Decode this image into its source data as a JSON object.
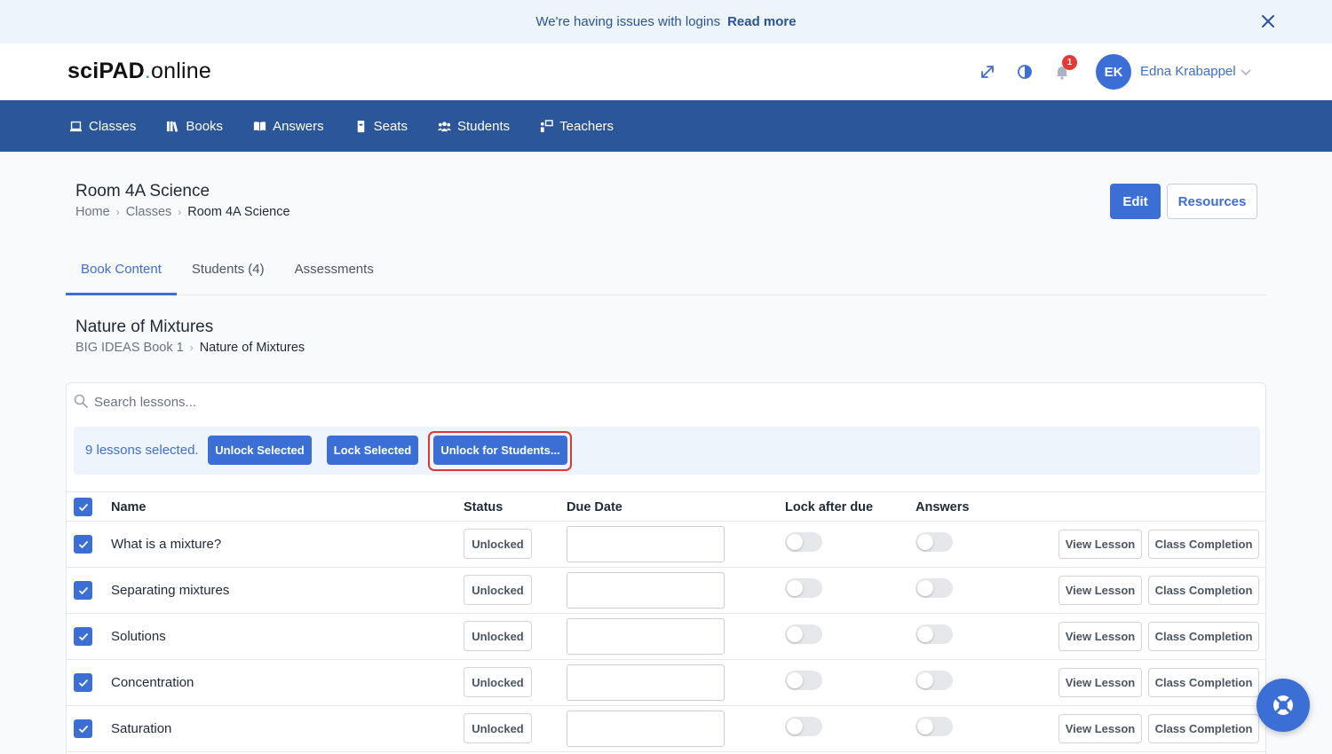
{
  "banner": {
    "message": "We're having issues with logins",
    "link": "Read more"
  },
  "header": {
    "logo": {
      "bold": "sciPAD",
      "dot": ".",
      "rest": "online"
    },
    "notification_count": "1",
    "user": {
      "initials": "EK",
      "name": "Edna Krabappel"
    }
  },
  "nav": {
    "items": [
      {
        "label": "Classes",
        "icon": "classes-icon"
      },
      {
        "label": "Books",
        "icon": "books-icon"
      },
      {
        "label": "Answers",
        "icon": "answers-icon"
      },
      {
        "label": "Seats",
        "icon": "seats-icon"
      },
      {
        "label": "Students",
        "icon": "students-icon"
      },
      {
        "label": "Teachers",
        "icon": "teachers-icon"
      }
    ]
  },
  "page": {
    "title": "Room 4A Science",
    "breadcrumb": [
      "Home",
      "Classes",
      "Room 4A Science"
    ],
    "edit_label": "Edit",
    "resources_label": "Resources"
  },
  "tabs": [
    {
      "label": "Book Content",
      "active": true
    },
    {
      "label": "Students (4)",
      "active": false
    },
    {
      "label": "Assessments",
      "active": false
    }
  ],
  "section": {
    "title": "Nature of Mixtures",
    "breadcrumb": [
      "BIG IDEAS Book 1",
      "Nature of Mixtures"
    ]
  },
  "search": {
    "placeholder": "Search lessons..."
  },
  "selection": {
    "text": "9 lessons selected.",
    "unlock_selected": "Unlock Selected",
    "lock_selected": "Lock Selected",
    "unlock_for_students": "Unlock for Students..."
  },
  "table": {
    "columns": {
      "name": "Name",
      "status": "Status",
      "due_date": "Due Date",
      "lock_after_due": "Lock after due",
      "answers": "Answers"
    },
    "view_lesson_label": "View Lesson",
    "class_completion_label": "Class Completion",
    "rows": [
      {
        "name": "What is a mixture?",
        "status": "Unlocked",
        "due_date": "",
        "checked": true,
        "lock_after_due": false,
        "answers": false
      },
      {
        "name": "Separating mixtures",
        "status": "Unlocked",
        "due_date": "",
        "checked": true,
        "lock_after_due": false,
        "answers": false
      },
      {
        "name": "Solutions",
        "status": "Unlocked",
        "due_date": "",
        "checked": true,
        "lock_after_due": false,
        "answers": false
      },
      {
        "name": "Concentration",
        "status": "Unlocked",
        "due_date": "",
        "checked": true,
        "lock_after_due": false,
        "answers": false
      },
      {
        "name": "Saturation",
        "status": "Unlocked",
        "due_date": "",
        "checked": true,
        "lock_after_due": false,
        "answers": false
      }
    ]
  },
  "colors": {
    "primary": "#3b6fd6",
    "nav": "#2b579a",
    "banner": "#eef4fc",
    "highlight": "#e03535"
  }
}
